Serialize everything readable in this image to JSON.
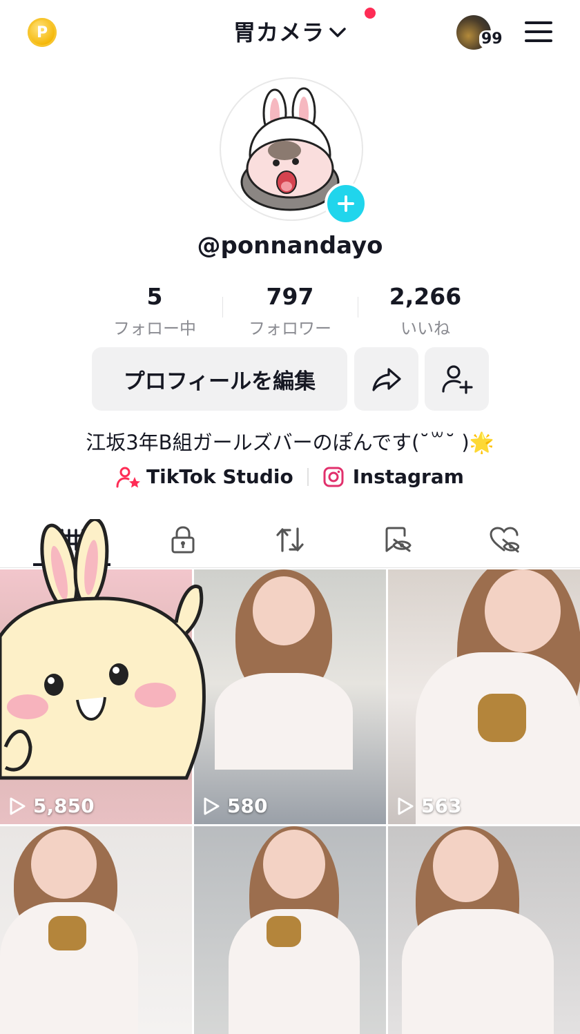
{
  "header": {
    "account_name": "胃カメラ",
    "notification_count": "99"
  },
  "profile": {
    "username": "@ponnandayo",
    "stats": [
      {
        "value": "5",
        "label": "フォロー中"
      },
      {
        "value": "797",
        "label": "フォロワー"
      },
      {
        "value": "2,266",
        "label": "いいね"
      }
    ],
    "edit_profile_label": "プロフィールを編集",
    "bio": "江坂3年B組ガールズバーのぽんです(˘꒳˘ )🌟",
    "links": {
      "studio_label": "TikTok Studio",
      "instagram_label": "Instagram"
    }
  },
  "tabs": [
    {
      "icon": "grid-icon"
    },
    {
      "icon": "lock-icon"
    },
    {
      "icon": "repost-icon"
    },
    {
      "icon": "eye-off-bookmark-icon"
    },
    {
      "icon": "heart-off-icon"
    }
  ],
  "videos": [
    {
      "views": "5,850"
    },
    {
      "views": "580"
    },
    {
      "views": "563"
    },
    {
      "views": ""
    },
    {
      "views": ""
    },
    {
      "views": ""
    }
  ],
  "colors": {
    "accent_pink": "#fe2c55",
    "accent_cyan": "#20d5ec",
    "text_primary": "#161823",
    "text_secondary": "#8a8b91"
  }
}
